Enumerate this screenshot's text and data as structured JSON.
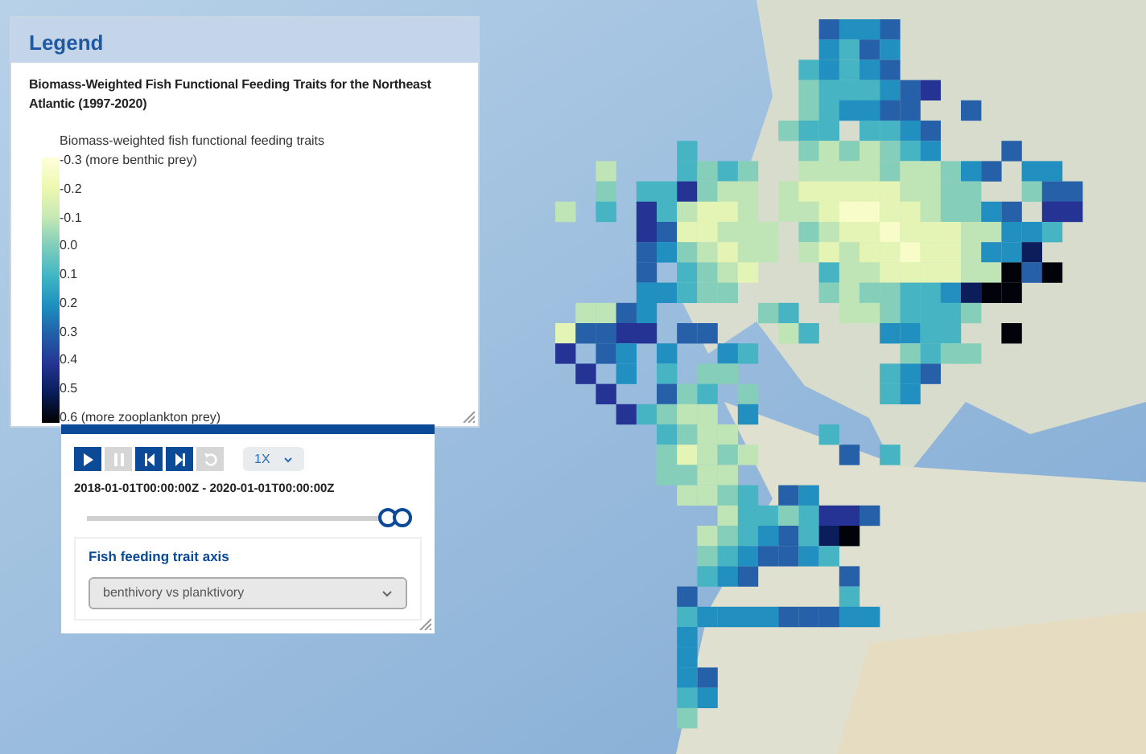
{
  "legend": {
    "title": "Legend",
    "heading": "Biomass-Weighted Fish Functional Feeding Traits for the Northeast Atlantic (1997-2020)",
    "scale_title": "Biomass-weighted fish functional feeding traits",
    "labels": [
      "-0.3 (more benthic prey)",
      "-0.2",
      "-0.1",
      "0.0",
      "0.1",
      "0.2",
      "0.3",
      "0.4",
      "0.5",
      "0.6 (more zooplankton prey)"
    ]
  },
  "player": {
    "buttons": [
      {
        "kind": "play",
        "disabled": false
      },
      {
        "kind": "pause",
        "disabled": true
      },
      {
        "kind": "back",
        "disabled": false
      },
      {
        "kind": "forward",
        "disabled": false
      },
      {
        "kind": "reset",
        "disabled": true
      }
    ],
    "speed": "1X",
    "time_range": "2018-01-01T00:00:00Z - 2020-01-01T00:00:00Z",
    "slider": {
      "start": {
        "level": 0.95
      },
      "end": {
        "level": 1.0
      }
    }
  },
  "axis_selector": {
    "label": "Fish feeding trait axis",
    "value": "benthivory vs planktivory"
  }
}
